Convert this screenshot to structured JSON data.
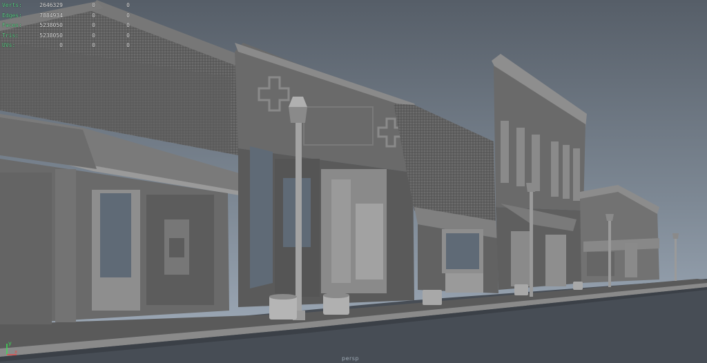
{
  "hud": {
    "rows": [
      {
        "label": "Verts:",
        "v1": "2646329",
        "v2": "0",
        "v3": "0"
      },
      {
        "label": "Edges:",
        "v1": "7884934",
        "v2": "0",
        "v3": "0"
      },
      {
        "label": "Faces:",
        "v1": "5238050",
        "v2": "0",
        "v3": "0"
      },
      {
        "label": "Tris:",
        "v1": "5238050",
        "v2": "0",
        "v3": "0"
      },
      {
        "label": "UVs:",
        "v1": "0",
        "v2": "0",
        "v3": "0"
      }
    ]
  },
  "axis": {
    "y_label": "y",
    "x_label": "x",
    "y_color": "#3ddc56",
    "x_color": "#e24a4a"
  },
  "camera": {
    "label": "persp"
  },
  "colors": {
    "sky_top": "#5b636d",
    "sky_bottom": "#9aa7b5",
    "ground": "#474d55",
    "building": "#6a6a6a",
    "building_dark": "#505050",
    "building_light": "#8e8e8e"
  }
}
